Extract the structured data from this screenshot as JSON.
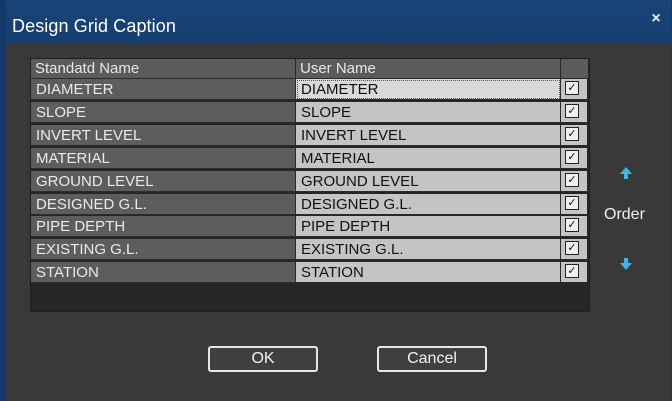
{
  "window": {
    "title": "Design Grid Caption",
    "close_symbol": "×"
  },
  "grid": {
    "columns": [
      "Standatd Name",
      "User Name",
      ""
    ],
    "rows": [
      {
        "standard": "DIAMETER",
        "user": "DIAMETER",
        "checked": true
      },
      {
        "standard": "SLOPE",
        "user": "SLOPE",
        "checked": true
      },
      {
        "standard": "INVERT LEVEL",
        "user": "INVERT LEVEL",
        "checked": true
      },
      {
        "standard": "MATERIAL",
        "user": "MATERIAL",
        "checked": true
      },
      {
        "standard": "GROUND LEVEL",
        "user": "GROUND LEVEL",
        "checked": true
      },
      {
        "standard": "DESIGNED G.L.",
        "user": "DESIGNED G.L.",
        "checked": true
      },
      {
        "standard": "PIPE DEPTH",
        "user": "PIPE DEPTH",
        "checked": true
      },
      {
        "standard": "EXISTING G.L.",
        "user": "EXISTING G.L.",
        "checked": true
      },
      {
        "standard": "STATION",
        "user": "STATION",
        "checked": true
      }
    ],
    "check_symbol": "✓"
  },
  "order": {
    "label": "Order",
    "up_icon": "arrow-up-icon",
    "down_icon": "arrow-down-icon",
    "accent": "#3cb8e8"
  },
  "buttons": {
    "ok_label": "OK",
    "cancel_label": "Cancel"
  }
}
